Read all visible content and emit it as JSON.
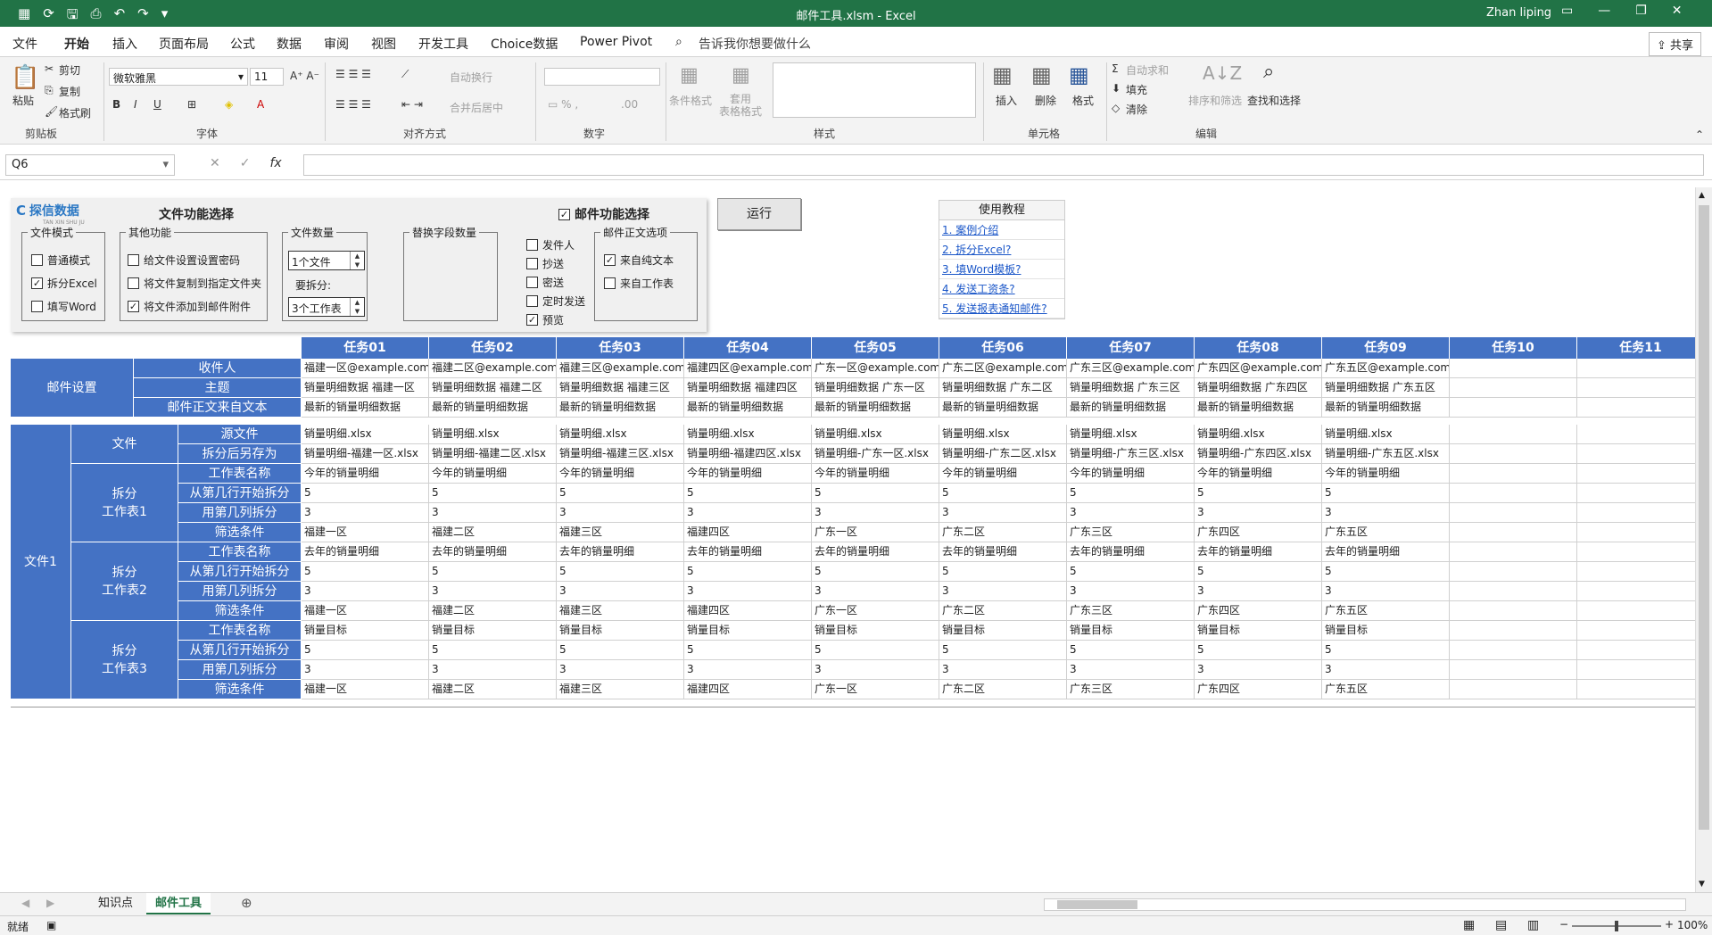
{
  "window": {
    "title": "邮件工具.xlsm  -  Excel",
    "user": "Zhan liping"
  },
  "menu": {
    "items": [
      "文件",
      "开始",
      "插入",
      "页面布局",
      "公式",
      "数据",
      "审阅",
      "视图",
      "开发工具",
      "Choice数据",
      "Power Pivot"
    ],
    "active_index": 1,
    "tell_me": "告诉我你想要做什么",
    "share": "共享"
  },
  "ribbon": {
    "clipboard": {
      "group": "剪贴板",
      "paste": "粘贴",
      "cut": "剪切",
      "copy": "复制",
      "format_painter": "格式刷"
    },
    "font": {
      "group": "字体",
      "name": "微软雅黑",
      "size": "11"
    },
    "align": {
      "group": "对齐方式",
      "wrap": "自动换行",
      "merge": "合并后居中"
    },
    "number": {
      "group": "数字"
    },
    "styles": {
      "group": "样式",
      "conditional": "条件格式",
      "table": "套用\n表格格式"
    },
    "cells": {
      "group": "单元格",
      "insert": "插入",
      "delete": "删除",
      "format": "格式"
    },
    "editing": {
      "group": "编辑",
      "autosum": "自动求和",
      "fill": "填充",
      "clear": "清除",
      "sort": "排序和筛选",
      "find": "查找和选择"
    }
  },
  "formula_bar": {
    "name_box": "Q6",
    "formula": ""
  },
  "panel": {
    "logo": "探信数据",
    "logo_sub": "TAN XIN SHU JU",
    "file_title": "文件功能选择",
    "mail_title": "邮件功能选择",
    "mail_checked": true,
    "file_mode": {
      "legend": "文件模式",
      "options": [
        {
          "label": "普通模式",
          "checked": false
        },
        {
          "label": "拆分Excel",
          "checked": true
        },
        {
          "label": "填写Word",
          "checked": false
        }
      ]
    },
    "other": {
      "legend": "其他功能",
      "options": [
        {
          "label": "给文件设置设置密码",
          "checked": false
        },
        {
          "label": "将文件复制到指定文件夹",
          "checked": false
        },
        {
          "label": "将文件添加到邮件附件",
          "checked": true
        }
      ]
    },
    "file_count": {
      "legend": "文件数量",
      "value": "1个文件",
      "split_label": "要拆分:",
      "split_value": "3个工作表"
    },
    "replace": {
      "legend": "替换字段数量"
    },
    "mail_opts": [
      {
        "label": "发件人",
        "checked": false
      },
      {
        "label": "抄送",
        "checked": false
      },
      {
        "label": "密送",
        "checked": false
      },
      {
        "label": "定时发送",
        "checked": false
      },
      {
        "label": "预览",
        "checked": true
      }
    ],
    "body": {
      "legend": "邮件正文选项",
      "options": [
        {
          "label": "来自纯文本",
          "checked": true
        },
        {
          "label": "来自工作表",
          "checked": false
        }
      ]
    }
  },
  "run_button": "运行",
  "tutorial": {
    "header": "使用教程",
    "links": [
      "1. 案例介绍",
      "2. 拆分Excel?",
      "3. 填Word模板?",
      "4. 发送工资条?",
      "5. 发送报表通知邮件?"
    ]
  },
  "table": {
    "tasks": [
      "任务01",
      "任务02",
      "任务03",
      "任务04",
      "任务05",
      "任务06",
      "任务07",
      "任务08",
      "任务09",
      "任务10",
      "任务11"
    ],
    "mail_group": "邮件设置",
    "mail_rows": [
      {
        "label": "收件人",
        "values": [
          "福建一区@example.com",
          "福建二区@example.com",
          "福建三区@example.com",
          "福建四区@example.com",
          "广东一区@example.com",
          "广东二区@example.com",
          "广东三区@example.com",
          "广东四区@example.com",
          "广东五区@example.com",
          "",
          ""
        ]
      },
      {
        "label": "主题",
        "values": [
          "销量明细数据 福建一区",
          "销量明细数据 福建二区",
          "销量明细数据 福建三区",
          "销量明细数据 福建四区",
          "销量明细数据 广东一区",
          "销量明细数据 广东二区",
          "销量明细数据 广东三区",
          "销量明细数据 广东四区",
          "销量明细数据 广东五区",
          "",
          ""
        ]
      },
      {
        "label": "邮件正文来自文本",
        "values": [
          "最新的销量明细数据",
          "最新的销量明细数据",
          "最新的销量明细数据",
          "最新的销量明细数据",
          "最新的销量明细数据",
          "最新的销量明细数据",
          "最新的销量明细数据",
          "最新的销量明细数据",
          "最新的销量明细数据",
          "",
          ""
        ]
      }
    ],
    "file_group": "文件1",
    "subgroups": [
      "文件",
      "拆分\n工作表1",
      "拆分\n工作表2",
      "拆分\n工作表3"
    ],
    "file_rows": [
      {
        "label": "源文件",
        "values": [
          "销量明细.xlsx",
          "销量明细.xlsx",
          "销量明细.xlsx",
          "销量明细.xlsx",
          "销量明细.xlsx",
          "销量明细.xlsx",
          "销量明细.xlsx",
          "销量明细.xlsx",
          "销量明细.xlsx",
          "",
          ""
        ]
      },
      {
        "label": "拆分后另存为",
        "values": [
          "销量明细-福建一区.xlsx",
          "销量明细-福建二区.xlsx",
          "销量明细-福建三区.xlsx",
          "销量明细-福建四区.xlsx",
          "销量明细-广东一区.xlsx",
          "销量明细-广东二区.xlsx",
          "销量明细-广东三区.xlsx",
          "销量明细-广东四区.xlsx",
          "销量明细-广东五区.xlsx",
          "",
          ""
        ]
      },
      {
        "label": "工作表名称",
        "values": [
          "今年的销量明细",
          "今年的销量明细",
          "今年的销量明细",
          "今年的销量明细",
          "今年的销量明细",
          "今年的销量明细",
          "今年的销量明细",
          "今年的销量明细",
          "今年的销量明细",
          "",
          ""
        ]
      },
      {
        "label": "从第几行开始拆分",
        "values": [
          "5",
          "5",
          "5",
          "5",
          "5",
          "5",
          "5",
          "5",
          "5",
          "",
          ""
        ]
      },
      {
        "label": "用第几列拆分",
        "values": [
          "3",
          "3",
          "3",
          "3",
          "3",
          "3",
          "3",
          "3",
          "3",
          "",
          ""
        ]
      },
      {
        "label": "筛选条件",
        "values": [
          "福建一区",
          "福建二区",
          "福建三区",
          "福建四区",
          "广东一区",
          "广东二区",
          "广东三区",
          "广东四区",
          "广东五区",
          "",
          ""
        ]
      },
      {
        "label": "工作表名称",
        "values": [
          "去年的销量明细",
          "去年的销量明细",
          "去年的销量明细",
          "去年的销量明细",
          "去年的销量明细",
          "去年的销量明细",
          "去年的销量明细",
          "去年的销量明细",
          "去年的销量明细",
          "",
          ""
        ]
      },
      {
        "label": "从第几行开始拆分",
        "values": [
          "5",
          "5",
          "5",
          "5",
          "5",
          "5",
          "5",
          "5",
          "5",
          "",
          ""
        ]
      },
      {
        "label": "用第几列拆分",
        "values": [
          "3",
          "3",
          "3",
          "3",
          "3",
          "3",
          "3",
          "3",
          "3",
          "",
          ""
        ]
      },
      {
        "label": "筛选条件",
        "values": [
          "福建一区",
          "福建二区",
          "福建三区",
          "福建四区",
          "广东一区",
          "广东二区",
          "广东三区",
          "广东四区",
          "广东五区",
          "",
          ""
        ]
      },
      {
        "label": "工作表名称",
        "values": [
          "销量目标",
          "销量目标",
          "销量目标",
          "销量目标",
          "销量目标",
          "销量目标",
          "销量目标",
          "销量目标",
          "销量目标",
          "",
          ""
        ]
      },
      {
        "label": "从第几行开始拆分",
        "values": [
          "5",
          "5",
          "5",
          "5",
          "5",
          "5",
          "5",
          "5",
          "5",
          "",
          ""
        ]
      },
      {
        "label": "用第几列拆分",
        "values": [
          "3",
          "3",
          "3",
          "3",
          "3",
          "3",
          "3",
          "3",
          "3",
          "",
          ""
        ]
      },
      {
        "label": "筛选条件",
        "values": [
          "福建一区",
          "福建二区",
          "福建三区",
          "福建四区",
          "广东一区",
          "广东二区",
          "广东三区",
          "广东四区",
          "广东五区",
          "",
          ""
        ]
      }
    ]
  },
  "sheets": {
    "tabs": [
      "知识点",
      "邮件工具"
    ],
    "active_index": 1
  },
  "status": {
    "ready": "就绪",
    "zoom": "100%"
  },
  "colors": {
    "excel_green": "#217346",
    "header_blue": "#4472c4"
  }
}
